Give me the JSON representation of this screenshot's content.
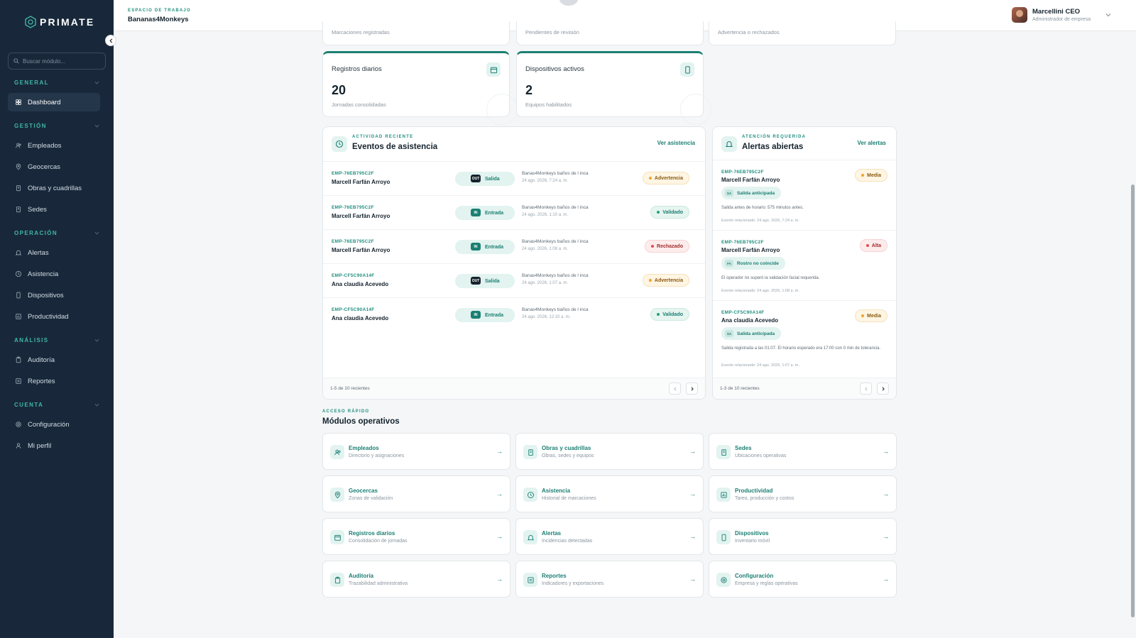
{
  "brand": {
    "name": "PRIMATE"
  },
  "sidebar": {
    "search_placeholder": "Buscar módulo...",
    "sections": [
      {
        "label": "GENERAL",
        "items": [
          {
            "label": "Dashboard",
            "icon": "grid-icon"
          }
        ]
      },
      {
        "label": "GESTIÓN",
        "items": [
          {
            "label": "Empleados",
            "icon": "users-icon"
          },
          {
            "label": "Geocercas",
            "icon": "map-pin-icon"
          },
          {
            "label": "Obras y cuadrillas",
            "icon": "building-icon"
          },
          {
            "label": "Sedes",
            "icon": "building-icon"
          }
        ]
      },
      {
        "label": "OPERACIÓN",
        "items": [
          {
            "label": "Alertas",
            "icon": "bell-icon"
          },
          {
            "label": "Asistencia",
            "icon": "clock-icon"
          },
          {
            "label": "Dispositivos",
            "icon": "phone-icon"
          },
          {
            "label": "Productividad",
            "icon": "chart-icon"
          }
        ]
      },
      {
        "label": "ANÁLISIS",
        "items": [
          {
            "label": "Auditoría",
            "icon": "clipboard-icon"
          },
          {
            "label": "Reportes",
            "icon": "report-icon"
          }
        ]
      },
      {
        "label": "CUENTA",
        "items": [
          {
            "label": "Configuración",
            "icon": "gear-icon"
          },
          {
            "label": "Mi perfil",
            "icon": "user-icon"
          }
        ]
      }
    ]
  },
  "topbar": {
    "workspace_label": "ESPACIO DE TRABAJO",
    "workspace_name": "Bananas4Monkeys",
    "user_name": "Marcellini CEO",
    "user_role": "Administrador de empresa"
  },
  "top_cards": [
    {
      "sub": "Marcaciones registradas"
    },
    {
      "sub": "Pendientes de revisión"
    },
    {
      "sub": "Advertencia o rechazados"
    }
  ],
  "stats": [
    {
      "title": "Registros diarios",
      "value": "20",
      "sub": "Jornadas consolidadas",
      "icon": "calendar-icon"
    },
    {
      "title": "Dispositivos activos",
      "value": "2",
      "sub": "Equipos habilitados",
      "icon": "phone-icon"
    }
  ],
  "events": {
    "eyebrow": "ACTIVIDAD RECIENTE",
    "title": "Eventos de asistencia",
    "link": "Ver asistencia",
    "rows": [
      {
        "code": "EMP-76EB795C2F",
        "name": "Marcell Farfán Arroyo",
        "tag": "OUT",
        "type": "Salida",
        "loc": "Banas4Monkeys baños de l inca",
        "date": "24 ago. 2026, 7:24 a. m.",
        "status": "Advertencia",
        "kind": "warn"
      },
      {
        "code": "EMP-76EB795C2F",
        "name": "Marcell Farfán Arroyo",
        "tag": "IN",
        "type": "Entrada",
        "loc": "Banas4Monkeys baños de l inca",
        "date": "24 ago. 2026, 1:10 a. m.",
        "status": "Validado",
        "kind": "ok"
      },
      {
        "code": "EMP-76EB795C2F",
        "name": "Marcell Farfán Arroyo",
        "tag": "IN",
        "type": "Entrada",
        "loc": "Banas4Monkeys baños de l inca",
        "date": "24 ago. 2026, 1:08 a. m.",
        "status": "Rechazado",
        "kind": "bad"
      },
      {
        "code": "EMP-CF5C90A14F",
        "name": "Ana claudia Acevedo",
        "tag": "OUT",
        "type": "Salida",
        "loc": "Banas4Monkeys baños de l inca",
        "date": "24 ago. 2026, 1:07 a. m.",
        "status": "Advertencia",
        "kind": "warn"
      },
      {
        "code": "EMP-CF5C90A14F",
        "name": "Ana claudia Acevedo",
        "tag": "IN",
        "type": "Entrada",
        "loc": "Banas4Monkeys baños de l inca",
        "date": "24 ago. 2026, 12:10 a. m.",
        "status": "Validado",
        "kind": "ok"
      }
    ],
    "footer": "1-5 de 10 recientes"
  },
  "alerts": {
    "eyebrow": "ATENCIÓN REQUERIDA",
    "title": "Alertas abiertas",
    "link": "Ver alertas",
    "items": [
      {
        "code": "EMP-76EB795C2F",
        "name": "Marcell Farfán Arroyo",
        "level": "Media",
        "kind": "warn",
        "chip_tag": "SA",
        "chip": "Salida anticipada",
        "desc": "Salida antes de horario: 575 minutos antes.",
        "event": "Evento relacionado: 24 ago. 2026, 7:24 a. m."
      },
      {
        "code": "EMP-76EB795C2F",
        "name": "Marcell Farfán Arroyo",
        "level": "Alta",
        "kind": "bad",
        "chip_tag": "FA",
        "chip": "Rostro no coincide",
        "desc": "El operador no superó la validación facial requerida.",
        "event": "Evento relacionado: 24 ago. 2026, 1:08 a. m."
      },
      {
        "code": "EMP-CF5C90A14F",
        "name": "Ana claudia Acevedo",
        "level": "Media",
        "kind": "warn",
        "chip_tag": "SA",
        "chip": "Salida anticipada",
        "desc": "Salida registrada a las 01:07. El horario esperado era 17:00 con 0 min de tolerancia.",
        "event": "Evento relacionado: 24 ago. 2026, 1:07 a. m."
      }
    ],
    "footer": "1-3 de 10 recientes"
  },
  "quick": {
    "eyebrow": "ACCESO RÁPIDO",
    "title": "Módulos operativos",
    "modules": [
      {
        "title": "Empleados",
        "sub": "Directorio y asignaciones",
        "icon": "users-icon"
      },
      {
        "title": "Obras y cuadrillas",
        "sub": "Obras, sedes y equipos",
        "icon": "building-icon"
      },
      {
        "title": "Sedes",
        "sub": "Ubicaciones operativas",
        "icon": "building-icon"
      },
      {
        "title": "Geocercas",
        "sub": "Zonas de validación",
        "icon": "map-pin-icon"
      },
      {
        "title": "Asistencia",
        "sub": "Historial de marcaciones",
        "icon": "clock-icon"
      },
      {
        "title": "Productividad",
        "sub": "Tareo, producción y costos",
        "icon": "chart-icon"
      },
      {
        "title": "Registros diarios",
        "sub": "Consolidación de jornadas",
        "icon": "calendar-icon"
      },
      {
        "title": "Alertas",
        "sub": "Incidencias detectadas",
        "icon": "bell-icon"
      },
      {
        "title": "Dispositivos",
        "sub": "Inventario móvil",
        "icon": "phone-icon"
      },
      {
        "title": "Auditoría",
        "sub": "Trazabilidad administrativa",
        "icon": "clipboard-icon"
      },
      {
        "title": "Reportes",
        "sub": "Indicadores y exportaciones",
        "icon": "report-icon"
      },
      {
        "title": "Configuración",
        "sub": "Empresa y reglas operativas",
        "icon": "gear-icon"
      }
    ]
  },
  "colors": {
    "sidebar": "#18283a",
    "accent": "#1b7f72",
    "warn": "#f0a22e",
    "bad": "#e14d4d",
    "ok": "#22a37f"
  }
}
